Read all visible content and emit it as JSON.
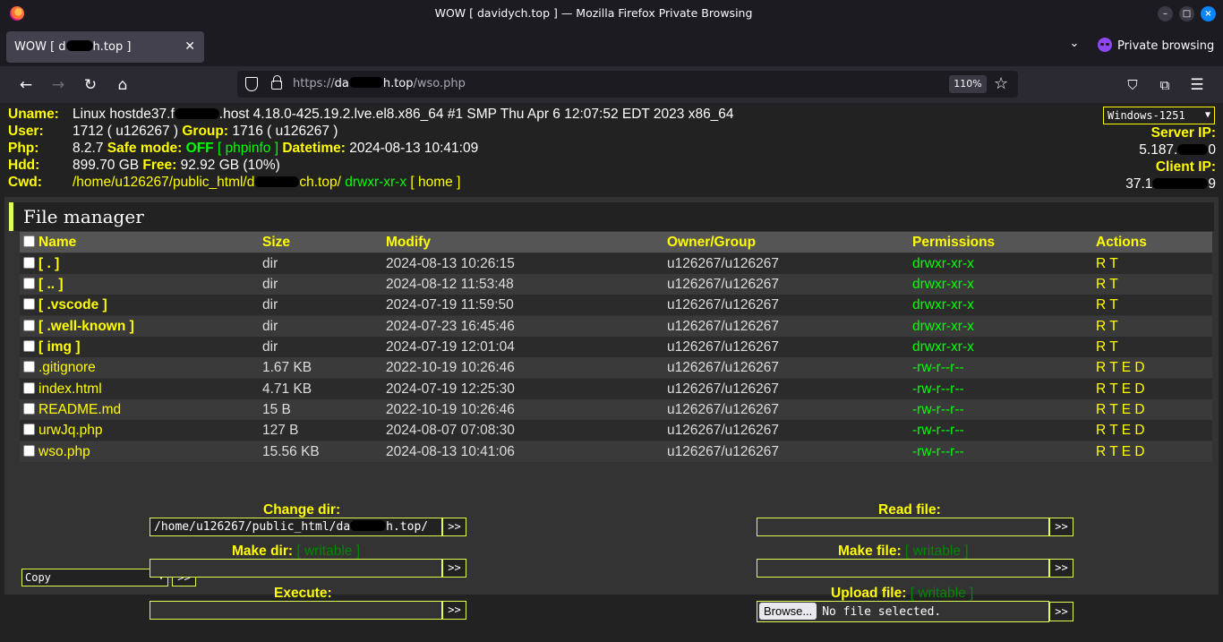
{
  "window": {
    "title": "WOW [ davidych.top ] — Mozilla Firefox Private Browsing",
    "tab_title_a": "WOW [ d",
    "tab_title_b": "h.top ]",
    "private_label": "Private browsing"
  },
  "url": {
    "prefix": "https://",
    "host_a": "da",
    "host_b": "h.top",
    "path": "/wso.php",
    "zoom": "110%"
  },
  "info": {
    "labels": [
      "Uname:",
      "User:",
      "Php:",
      "Hdd:",
      "Cwd:"
    ],
    "uname_a": "Linux hostde37.f",
    "uname_b": ".host 4.18.0-425.19.2.lve.el8.x86_64 #1 SMP Thu Apr 6 12:07:52 EDT 2023 x86_64",
    "user_uid": "1712 ( u126267 ) ",
    "group_label": "Group:",
    "user_gid": " 1716 ( u126267 )",
    "php_version": "8.2.7 ",
    "safe_mode_label": "Safe mode:",
    "safe_mode_value": " OFF ",
    "phpinfo_link": "[ phpinfo ]",
    "datetime_label": " Datetime:",
    "datetime_value": " 2024-08-13 10:41:09",
    "hdd_total": "899.70 GB ",
    "free_label": "Free:",
    "hdd_free": " 92.92 GB (10%)",
    "cwd_a": "/home/u126267/public_html/d",
    "cwd_b": "ch.top/",
    "cwd_perms": " drwxr-xr-x ",
    "home_link": "[ home ]",
    "charset": "Windows-1251",
    "server_ip_label": "Server IP:",
    "server_ip": "5.187.",
    "server_ip_tail": "0",
    "client_ip_label": "Client IP:",
    "client_ip": "37.1",
    "client_ip_tail": "9"
  },
  "file_manager": {
    "title": "File manager",
    "columns": [
      "Name",
      "Size",
      "Modify",
      "Owner/Group",
      "Permissions",
      "Actions"
    ],
    "rows": [
      {
        "name": "[ . ]",
        "size": "dir",
        "modify": "2024-08-13 10:26:15",
        "owner": "u126267/u126267",
        "perms": "drwxr-xr-x",
        "actions": "R T"
      },
      {
        "name": "[ .. ]",
        "size": "dir",
        "modify": "2024-08-12 11:53:48",
        "owner": "u126267/u126267",
        "perms": "drwxr-xr-x",
        "actions": "R T"
      },
      {
        "name": "[ .vscode ]",
        "size": "dir",
        "modify": "2024-07-19 11:59:50",
        "owner": "u126267/u126267",
        "perms": "drwxr-xr-x",
        "actions": "R T"
      },
      {
        "name": "[ .well-known ]",
        "size": "dir",
        "modify": "2024-07-23 16:45:46",
        "owner": "u126267/u126267",
        "perms": "drwxr-xr-x",
        "actions": "R T"
      },
      {
        "name": "[ img ]",
        "size": "dir",
        "modify": "2024-07-19 12:01:04",
        "owner": "u126267/u126267",
        "perms": "drwxr-xr-x",
        "actions": "R T"
      },
      {
        "name": ".gitignore",
        "size": "1.67 KB",
        "modify": "2022-10-19 10:26:46",
        "owner": "u126267/u126267",
        "perms": "-rw-r--r--",
        "actions": "R T E D"
      },
      {
        "name": "index.html",
        "size": "4.71 KB",
        "modify": "2024-07-19 12:25:30",
        "owner": "u126267/u126267",
        "perms": "-rw-r--r--",
        "actions": "R T E D"
      },
      {
        "name": "README.md",
        "size": "15 B",
        "modify": "2022-10-19 10:26:46",
        "owner": "u126267/u126267",
        "perms": "-rw-r--r--",
        "actions": "R T E D"
      },
      {
        "name": "urwJq.php",
        "size": "127 B",
        "modify": "2024-08-07 07:08:30",
        "owner": "u126267/u126267",
        "perms": "-rw-r--r--",
        "actions": "R T E D"
      },
      {
        "name": "wso.php",
        "size": "15.56 KB",
        "modify": "2024-08-13 10:41:06",
        "owner": "u126267/u126267",
        "perms": "-rw-r--r--",
        "actions": "R T E D"
      }
    ],
    "bulk_action": "Copy",
    "go_label": ">>"
  },
  "forms": {
    "change_dir_label": "Change dir:",
    "change_dir_value_a": "/home/u126267/public_html/da",
    "change_dir_value_b": "h.top/",
    "read_file_label": "Read file:",
    "make_dir_label": "Make dir:",
    "make_file_label": "Make file:",
    "writable": "[ writable ]",
    "execute_label": "Execute:",
    "upload_label": "Upload file:",
    "browse_label": "Browse...",
    "no_file": "No file selected.",
    "go_label": ">>"
  }
}
